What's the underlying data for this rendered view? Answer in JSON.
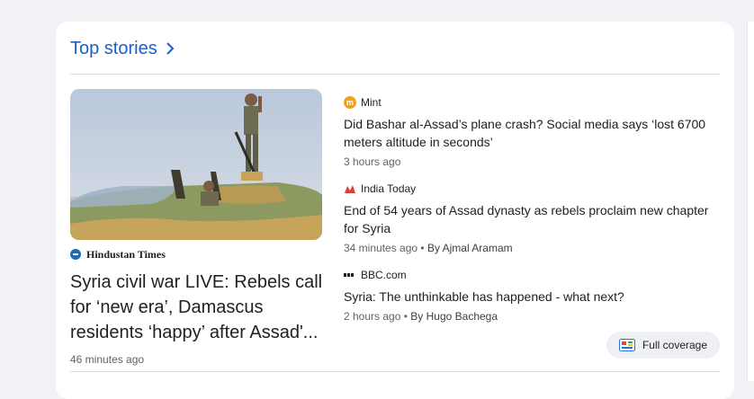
{
  "section": {
    "title": "Top stories"
  },
  "lead": {
    "source": "Hindustan Times",
    "title": "Syria civil war LIVE: Rebels call for ‘new era’, Damascus residents ‘happy’ after Assad'...",
    "time": "46 minutes ago"
  },
  "stories": [
    {
      "source": "Mint",
      "title": "Did Bashar al-Assad’s plane crash? Social media says ‘lost 6700 meters altitude in seconds’",
      "time": "3 hours ago",
      "author": ""
    },
    {
      "source": "India Today",
      "title": "End of 54 years of Assad dynasty as rebels proclaim new chapter for Syria",
      "time": "34 minutes ago",
      "author": "By Ajmal Aramam"
    },
    {
      "source": "BBC.com",
      "title": "Syria: The unthinkable has happened - what next?",
      "time": "2 hours ago",
      "author": "By Hugo Bachega"
    }
  ],
  "full_coverage": {
    "label": "Full coverage"
  },
  "colors": {
    "accent": "#1a5fcc",
    "mint": "#f0a21b",
    "india_today": "#d6423a",
    "hindustan_times": "#1b6bb0"
  },
  "icons": [
    "chevron-right-icon",
    "full-coverage-icon"
  ]
}
